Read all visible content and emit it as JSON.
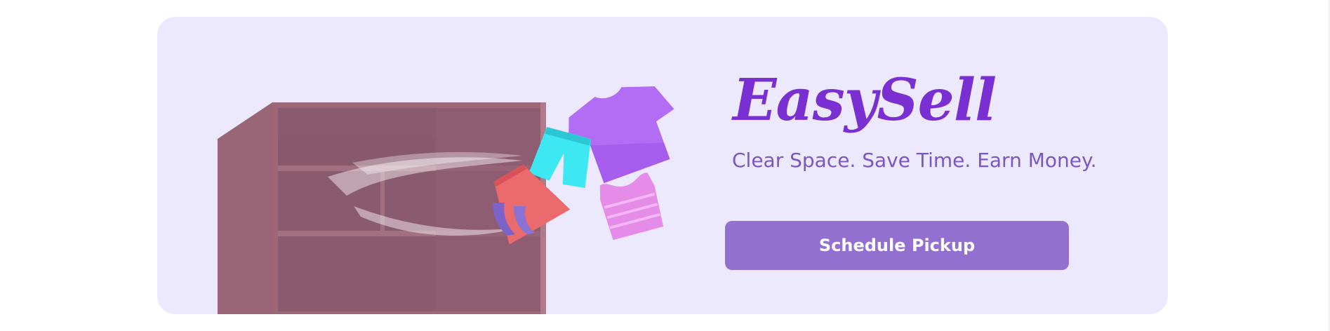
{
  "hero": {
    "brand": "EasySell",
    "tagline": "Clear Space. Save Time. Earn Money.",
    "cta_label": "Schedule Pickup"
  },
  "colors": {
    "page_background": "#ffffff",
    "card_background": "#ece8fd",
    "brand_text": "#7a2fd2",
    "tagline_text": "#7a57c4",
    "button_background": "#9370cf",
    "button_text": "#ffffff",
    "cabinet": "#9a6577",
    "cabinet_shadow": "#87586c"
  },
  "illustration": {
    "description_icons": [
      "cabinet-icon",
      "tshirt-icon",
      "shorts-icon",
      "skirt-icon",
      "sleeveless-top-icon",
      "high-heel-shoes-icon"
    ]
  }
}
